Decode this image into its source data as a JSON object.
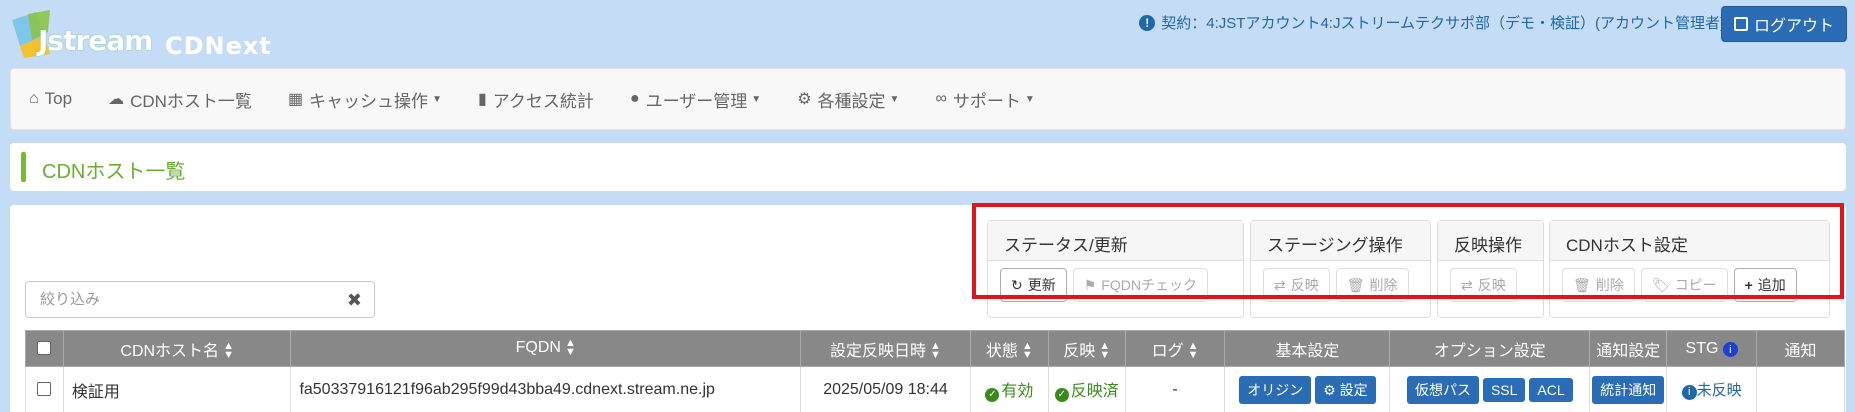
{
  "header": {
    "brand": "Jstream",
    "product": "CDNext",
    "contract_text": "契約：4:JSTアカウント4:Jストリームテクサポ部（デモ・検証）(アカウント管理者)",
    "logout_label": "ログアウト"
  },
  "nav": {
    "items": [
      {
        "label": "Top",
        "icon": "home-icon"
      },
      {
        "label": "CDNホスト一覧",
        "icon": "cloud-icon"
      },
      {
        "label": "キャッシュ操作",
        "icon": "grid-icon"
      },
      {
        "label": "アクセス統計",
        "icon": "bar-chart-icon"
      },
      {
        "label": "ユーザー管理",
        "icon": "user-icon"
      },
      {
        "label": "各種設定",
        "icon": "gear-icon"
      },
      {
        "label": "サポート",
        "icon": "link-icon"
      }
    ]
  },
  "page": {
    "title": "CDNホスト一覧"
  },
  "groups": {
    "status": {
      "title": "ステータス/更新",
      "refresh": "更新",
      "fqdn_check": "FQDNチェック"
    },
    "staging": {
      "title": "ステージング操作",
      "reflect": "反映",
      "delete": "削除"
    },
    "reflect": {
      "title": "反映操作",
      "reflect": "反映"
    },
    "host": {
      "title": "CDNホスト設定",
      "delete": "削除",
      "copy": "コピー",
      "add": "追加"
    }
  },
  "filter": {
    "placeholder": "絞り込み"
  },
  "table": {
    "headers": [
      "CDNホスト名",
      "FQDN",
      "設定反映日時",
      "状態",
      "反映",
      "ログ",
      "基本設定",
      "オプション設定",
      "通知設定",
      "STG",
      "通知"
    ],
    "rows": [
      {
        "name": "検証用",
        "fqdn": "fa50337916121f96ab295f99d43bba49.cdnext.stream.ne.jp",
        "updated": "2025/05/09 18:44",
        "status": "有効",
        "reflect": "反映済",
        "log": "-",
        "basic": [
          "オリジン",
          "設定"
        ],
        "option": [
          "仮想パス",
          "SSL",
          "ACL"
        ],
        "notify": "統計通知",
        "stg": "未反映"
      }
    ]
  }
}
